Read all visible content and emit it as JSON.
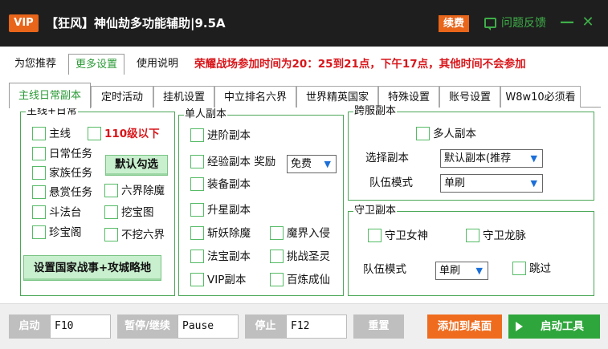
{
  "titlebar": {
    "vip_badge": "VIP",
    "title": "【狂风】神仙劫多功能辅助|9.5A",
    "renew_button": "续费",
    "feedback_label": "问题反馈",
    "minimize": "—",
    "close": "✕"
  },
  "top_tabs": [
    {
      "label": "为您推荐"
    },
    {
      "label": "更多设置"
    },
    {
      "label": "使用说明"
    }
  ],
  "notice": "荣耀战场参加时间为20：25到21点，下午17点，其他时间不会参加",
  "sub_tabs": [
    {
      "label": "主线日常副本"
    },
    {
      "label": "定时活动"
    },
    {
      "label": "挂机设置"
    },
    {
      "label": "中立排名六界"
    },
    {
      "label": "世界精英国家"
    },
    {
      "label": "特殊设置"
    },
    {
      "label": "账号设置"
    },
    {
      "label": "W8w10必须看"
    }
  ],
  "main_daily": {
    "legend": "主线+日常",
    "main_line": "主线",
    "below_110": "110级以下",
    "daily_task": "日常任务",
    "default_check_button": "默认勾选",
    "family_task": "家族任务",
    "bounty_task": "悬赏任务",
    "six_realms": "六界除魔",
    "arena": "斗法台",
    "treasure_map": "挖宝图",
    "treasure_pavilion": "珍宝阁",
    "no_dig_six": "不挖六界",
    "nation_war_button": "设置国家战事+攻城略地"
  },
  "single_dungeon": {
    "legend": "单人副本",
    "advanced": "进阶副本",
    "experience": "经验副本 奖励",
    "experience_select": "免费",
    "equipment": "装备副本",
    "upgrade": "升星副本",
    "slay_demon": "斩妖除魔",
    "demon_invasion": "魔界入侵",
    "magic_weapon": "法宝副本",
    "challenge_sage": "挑战圣灵",
    "vip": "VIP副本",
    "refine_immortal": "百炼成仙"
  },
  "cross_server": {
    "legend": "跨服副本",
    "multi_dungeon": "多人副本",
    "select_label": "选择副本",
    "select_value": "默认副本(推荐",
    "team_label": "队伍模式",
    "team_value": "单刷"
  },
  "guard": {
    "legend": "守卫副本",
    "guard_goddess": "守卫女神",
    "guard_dragon": "守卫龙脉",
    "team_label": "队伍模式",
    "team_value": "单刷",
    "skip": "跳过"
  },
  "bottom": {
    "start_label": "启动",
    "start_key": "F10",
    "pause_label": "暂停/继续",
    "pause_key": "Pause",
    "stop_label": "停止",
    "stop_key": "F12",
    "reset_label": "重置",
    "desktop_label": "添加到桌面",
    "launch_label": "启动工具"
  },
  "colors": {
    "titlebar": "#1e1e1e",
    "accent_orange": "#e8651a",
    "accent_green": "#2fa63b",
    "notice_red": "#d8161b"
  }
}
